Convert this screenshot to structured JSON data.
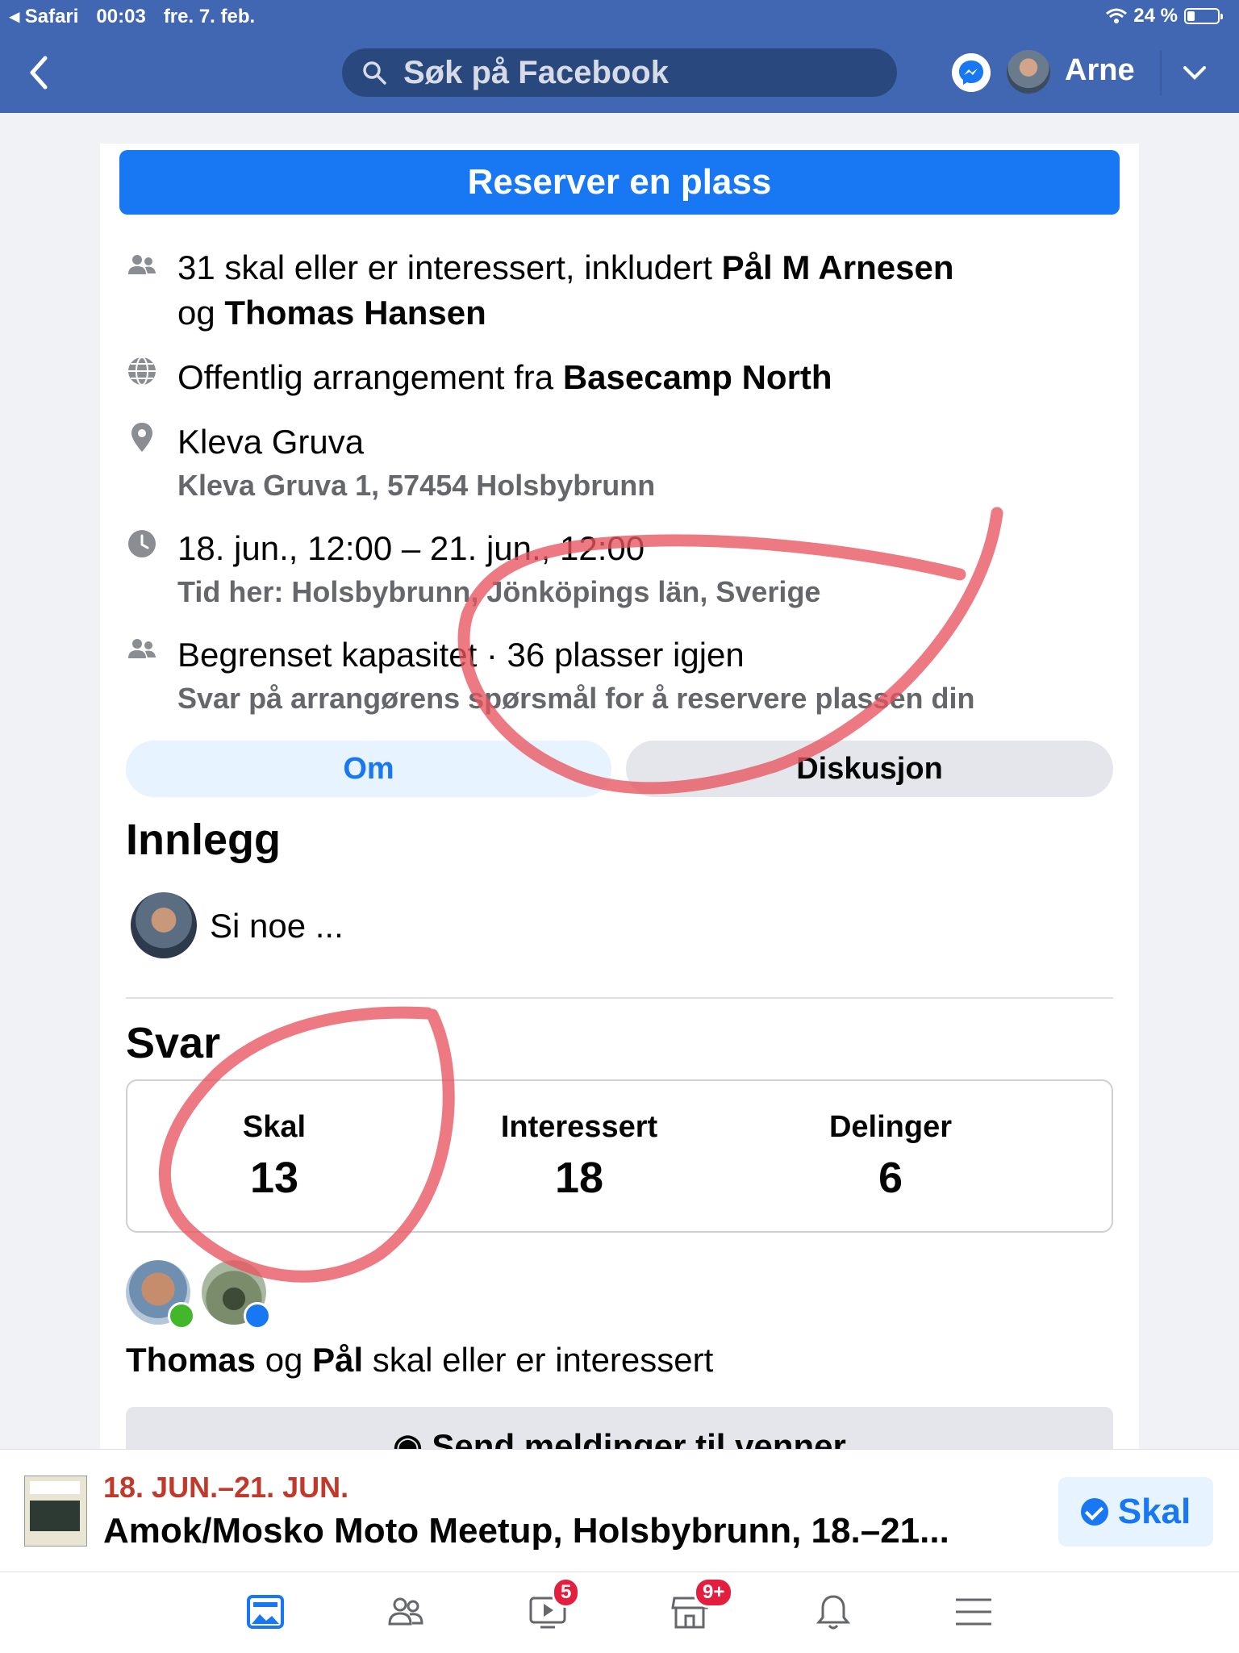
{
  "status_bar": {
    "back_app": "Safari",
    "time": "00:03",
    "date": "fre. 7. feb.",
    "battery": "24 %",
    "battery_level": 0.24
  },
  "header": {
    "search_placeholder": "Søk på Facebook",
    "user_name": "Arne"
  },
  "event": {
    "reserve_label": "Reserver en plass",
    "going_text_1": "31 skal eller er interessert, inkludert ",
    "going_name_1": "Pål M Arnesen",
    "going_text_2": "og ",
    "going_name_2": "Thomas Hansen",
    "public_text": "Offentlig arrangement fra ",
    "organizer": "Basecamp North",
    "location_name": "Kleva Gruva",
    "location_address": "Kleva Gruva 1, 57454 Holsbybrunn",
    "time_range": "18. jun., 12:00 – 21. jun., 12:00",
    "time_local": "Tid her: Holsbybrunn, Jönköpings län, Sverige",
    "capacity": "Begrenset kapasitet · 36 plasser igjen",
    "capacity_sub": "Svar på arrangørens spørsmål for å reservere plassen din"
  },
  "tabs": {
    "about": "Om",
    "discussion": "Diskusjon"
  },
  "posts": {
    "heading": "Innlegg",
    "composer_placeholder": "Si noe ..."
  },
  "responses": {
    "heading": "Svar",
    "going_label": "Skal",
    "going_value": "13",
    "interested_label": "Interessert",
    "interested_value": "18",
    "shares_label": "Delinger",
    "shares_value": "6",
    "friends_name_1": "Thomas",
    "friends_og": " og ",
    "friends_name_2": "Pål",
    "friends_suffix": " skal eller er interessert",
    "send_messages": "Send meldinger til venner"
  },
  "sticky": {
    "date": "18. JUN.–21. JUN.",
    "title": "Amok/Mosko Moto Meetup, Holsbybrunn, 18.–21...",
    "skal_button": "Skal"
  },
  "tabbar": {
    "icons": [
      "news-feed-icon",
      "friends-icon",
      "watch-icon",
      "marketplace-icon",
      "notifications-icon",
      "menu-icon"
    ],
    "watch_badge": "5",
    "marketplace_badge": "9+"
  },
  "colors": {
    "brand": "#4267b2",
    "primary": "#1877f2",
    "annotation": "#e8555f"
  }
}
